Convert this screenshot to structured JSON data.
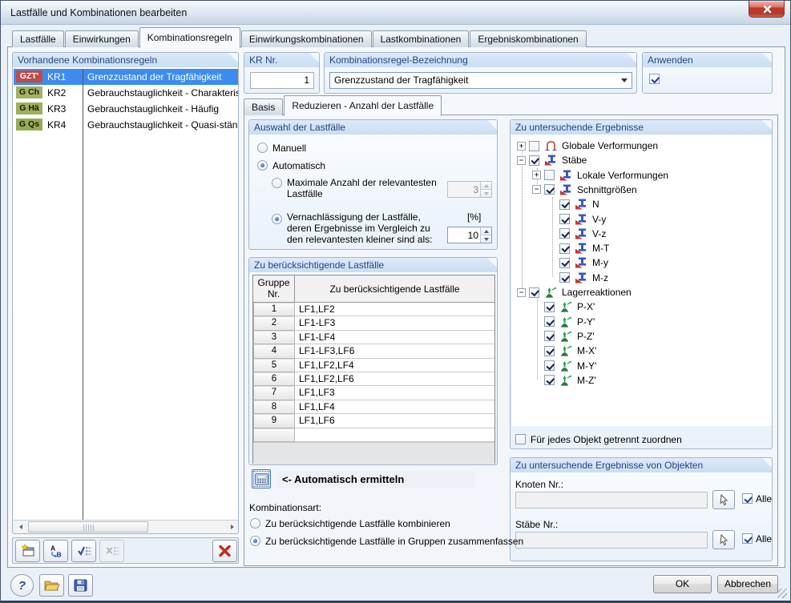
{
  "window": {
    "title": "Lastfälle und Kombinationen bearbeiten"
  },
  "tabs": [
    {
      "label": "Lastfälle",
      "active": false
    },
    {
      "label": "Einwirkungen",
      "active": false
    },
    {
      "label": "Kombinationsregeln",
      "active": true
    },
    {
      "label": "Einwirkungskombinationen",
      "active": false
    },
    {
      "label": "Lastkombinationen",
      "active": false
    },
    {
      "label": "Ergebniskombinationen",
      "active": false
    }
  ],
  "left_panel": {
    "title": "Vorhandene Kombinationsregeln",
    "rows": [
      {
        "badge": "GZT'",
        "badge_color": "#BE4B48",
        "badge_text_color": "#FFFFFF",
        "id": "KR1",
        "desc": "Grenzzustand der Tragfähigkeit",
        "selected": true
      },
      {
        "badge": "G Ch",
        "badge_color": "#A4B266",
        "badge_text_color": "#1A1A00",
        "id": "KR2",
        "desc": "Gebrauchstauglichkeit - Charakteristisch",
        "selected": false
      },
      {
        "badge": "G Hä",
        "badge_color": "#9DB05F",
        "badge_text_color": "#1A1A00",
        "id": "KR3",
        "desc": "Gebrauchstauglichkeit - Häufig",
        "selected": false
      },
      {
        "badge": "G Qs",
        "badge_color": "#97AC58",
        "badge_text_color": "#1A1A00",
        "id": "KR4",
        "desc": "Gebrauchstauglichkeit - Quasi-ständig",
        "selected": false
      }
    ],
    "toolbar": [
      {
        "name": "new-rule-button",
        "icon": "new-window-icon",
        "enabled": true
      },
      {
        "name": "renumber-button",
        "icon": "sort-ab-icon",
        "enabled": true
      },
      {
        "name": "check-all-button",
        "icon": "check-list-icon",
        "enabled": true
      },
      {
        "name": "uncheck-all-button",
        "icon": "uncheck-list-icon",
        "enabled": false
      },
      {
        "name": "delete-rule-button",
        "icon": "delete-x-icon",
        "enabled": true
      }
    ]
  },
  "kr_nr": {
    "label": "KR Nr.",
    "value": "1"
  },
  "bezeichnung": {
    "label": "Kombinationsregel-Bezeichnung",
    "value": "Grenzzustand der Tragfähigkeit"
  },
  "anwenden": {
    "label": "Anwenden",
    "checked": true
  },
  "subtabs": [
    {
      "label": "Basis",
      "active": false
    },
    {
      "label": "Reduzieren - Anzahl der Lastfälle",
      "active": true
    }
  ],
  "auswahl": {
    "title": "Auswahl der Lastfälle",
    "manuell": {
      "label": "Manuell",
      "selected": false
    },
    "automatisch": {
      "label": "Automatisch",
      "selected": true
    },
    "max_anzahl": {
      "label": "Maximale Anzahl der relevantesten Lastfälle",
      "selected": false,
      "value": "3",
      "enabled": false
    },
    "vernachlaessigung": {
      "label": "Vernachlässigung der Lastfälle, deren Ergebnisse im Vergleich zu den relevantesten kleiner sind als:",
      "selected": true,
      "unit": "[%]",
      "value": "10",
      "enabled": true
    }
  },
  "gruppen_table": {
    "title": "Zu berücksichtigende Lastfälle",
    "col1_line1": "Gruppe",
    "col1_line2": "Nr.",
    "col2": "Zu berücksichtigende Lastfälle",
    "rows": [
      [
        "1",
        "LF1,LF2"
      ],
      [
        "2",
        "LF1-LF3"
      ],
      [
        "3",
        "LF1-LF4"
      ],
      [
        "4",
        "LF1-LF3,LF6"
      ],
      [
        "5",
        "LF1,LF2,LF4"
      ],
      [
        "6",
        "LF1,LF2,LF6"
      ],
      [
        "7",
        "LF1,LF3"
      ],
      [
        "8",
        "LF1,LF4"
      ],
      [
        "9",
        "LF1,LF6"
      ]
    ]
  },
  "auto_ermitteln": {
    "label": "<- Automatisch ermitteln",
    "icon": "calculator-icon"
  },
  "kombinationsart": {
    "label": "Kombinationsart:",
    "options": [
      {
        "label": "Zu berücksichtigende Lastfälle kombinieren",
        "selected": false
      },
      {
        "label": "Zu berücksichtigende Lastfälle in Gruppen zusammenfassen",
        "selected": true
      }
    ]
  },
  "ergebnisse_tree": {
    "title": "Zu untersuchende Ergebnisse",
    "items": [
      {
        "level": 0,
        "expander": "plus",
        "checked": false,
        "icon": "frame-icon",
        "label": "Globale Verformungen"
      },
      {
        "level": 0,
        "expander": "minus",
        "checked": true,
        "icon": "beam-icon",
        "label": "Stäbe"
      },
      {
        "level": 1,
        "expander": "plus",
        "checked": false,
        "icon": "beam-icon",
        "label": "Lokale Verformungen"
      },
      {
        "level": 1,
        "expander": "minus",
        "checked": true,
        "icon": "beam-icon",
        "label": "Schnittgrößen"
      },
      {
        "level": 2,
        "expander": "none",
        "checked": true,
        "icon": "beam-icon",
        "label": "N"
      },
      {
        "level": 2,
        "expander": "none",
        "checked": true,
        "icon": "beam-icon",
        "label": "V-y"
      },
      {
        "level": 2,
        "expander": "none",
        "checked": true,
        "icon": "beam-icon",
        "label": "V-z"
      },
      {
        "level": 2,
        "expander": "none",
        "checked": true,
        "icon": "beam-icon",
        "label": "M-T"
      },
      {
        "level": 2,
        "expander": "none",
        "checked": true,
        "icon": "beam-icon",
        "label": "M-y"
      },
      {
        "level": 2,
        "expander": "none",
        "checked": true,
        "icon": "beam-icon",
        "label": "M-z"
      },
      {
        "level": 0,
        "expander": "minus",
        "checked": true,
        "icon": "support-icon",
        "label": "Lagerreaktionen"
      },
      {
        "level": 1,
        "expander": "none",
        "checked": true,
        "icon": "support-icon",
        "label": "P-X'"
      },
      {
        "level": 1,
        "expander": "none",
        "checked": true,
        "icon": "support-icon",
        "label": "P-Y'"
      },
      {
        "level": 1,
        "expander": "none",
        "checked": true,
        "icon": "support-icon",
        "label": "P-Z'"
      },
      {
        "level": 1,
        "expander": "none",
        "checked": true,
        "icon": "support-icon",
        "label": "M-X'"
      },
      {
        "level": 1,
        "expander": "none",
        "checked": true,
        "icon": "support-icon",
        "label": "M-Y'"
      },
      {
        "level": 1,
        "expander": "none",
        "checked": true,
        "icon": "support-icon",
        "label": "M-Z'"
      }
    ],
    "footer_checkbox": {
      "label": "Für jedes Objekt getrennt zuordnen",
      "checked": false
    }
  },
  "objekte": {
    "title": "Zu untersuchende Ergebnisse von Objekten",
    "knoten": {
      "label": "Knoten Nr.:",
      "value": "",
      "alle": "Alle",
      "alle_checked": true
    },
    "staebe": {
      "label": "Stäbe Nr.:",
      "value": "",
      "alle": "Alle",
      "alle_checked": true
    }
  },
  "footer": {
    "ok": "OK",
    "cancel": "Abbrechen"
  },
  "colors": {
    "selection_blue": "#3C8CF0",
    "badge_red": "#BE4B48",
    "badge_olive": "#A4B266",
    "panel_header_text": "#1D4583",
    "close_button_red": "#C0392B",
    "delete_red": "#C22D21"
  }
}
